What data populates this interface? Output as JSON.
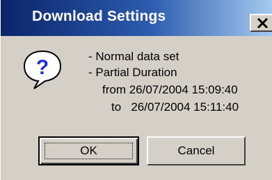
{
  "window": {
    "title": "Download Settings"
  },
  "icon": {
    "name": "question-icon",
    "glyph": "?"
  },
  "message": {
    "line1": "- Normal data set",
    "line2": "- Partial Duration",
    "line3": "from 26/07/2004 15:09:40",
    "line4": "to   26/07/2004 15:11:40"
  },
  "buttons": {
    "ok_label": "OK",
    "cancel_label": "Cancel"
  },
  "colors": {
    "title_bar_start": "#0a246a",
    "title_bar_end": "#a6caf0",
    "dialog_face": "#d4d0c8",
    "icon_blue": "#1c2fd0"
  }
}
